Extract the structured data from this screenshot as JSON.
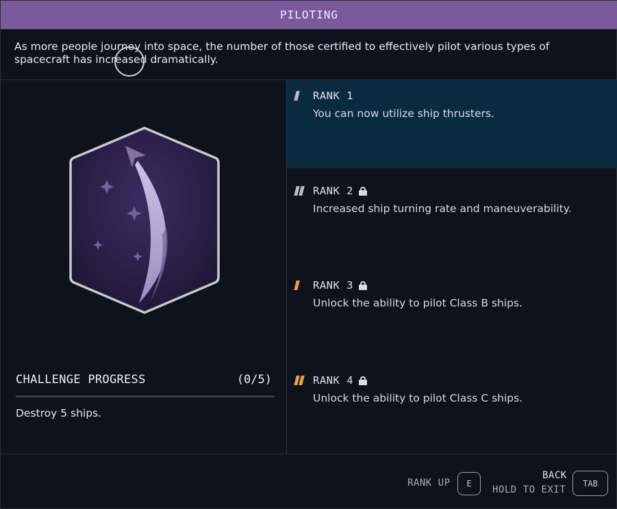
{
  "header": {
    "title": "PILOTING"
  },
  "description": "As more people journey into space, the number of those certified to effectively pilot various types of spacecraft has increased dramatically.",
  "challenge": {
    "title": "CHALLENGE PROGRESS",
    "count": "(0/5)",
    "progress": 0,
    "task": "Destroy 5 ships."
  },
  "ranks": [
    {
      "label": "RANK 1",
      "desc": "You can now utilize ship thrusters.",
      "locked": false,
      "active": true,
      "marks": 1,
      "mark_color": "#b9bdc7"
    },
    {
      "label": "RANK 2",
      "desc": "Increased ship turning rate and maneuverability.",
      "locked": true,
      "active": false,
      "marks": 2,
      "mark_color": "#b9bdc7"
    },
    {
      "label": "RANK 3",
      "desc": "Unlock the ability to pilot Class B ships.",
      "locked": true,
      "active": false,
      "marks": 1,
      "mark_color": "#e8a03a"
    },
    {
      "label": "RANK 4",
      "desc": "Unlock the ability to pilot Class C ships.",
      "locked": true,
      "active": false,
      "marks": 2,
      "mark_color": "#e8a03a"
    }
  ],
  "footer": {
    "rank_up_label": "RANK UP",
    "rank_up_key": "E",
    "back_label": "BACK",
    "hold_label": "HOLD TO EXIT",
    "back_key": "TAB"
  },
  "colors": {
    "header_bg": "#7b5a9c",
    "active_rank_bg": "#0a2a40",
    "badge_bg": "#2a1f45"
  },
  "icons": {
    "badge": "piloting-skill-patch-icon",
    "lock": "lock-icon"
  }
}
